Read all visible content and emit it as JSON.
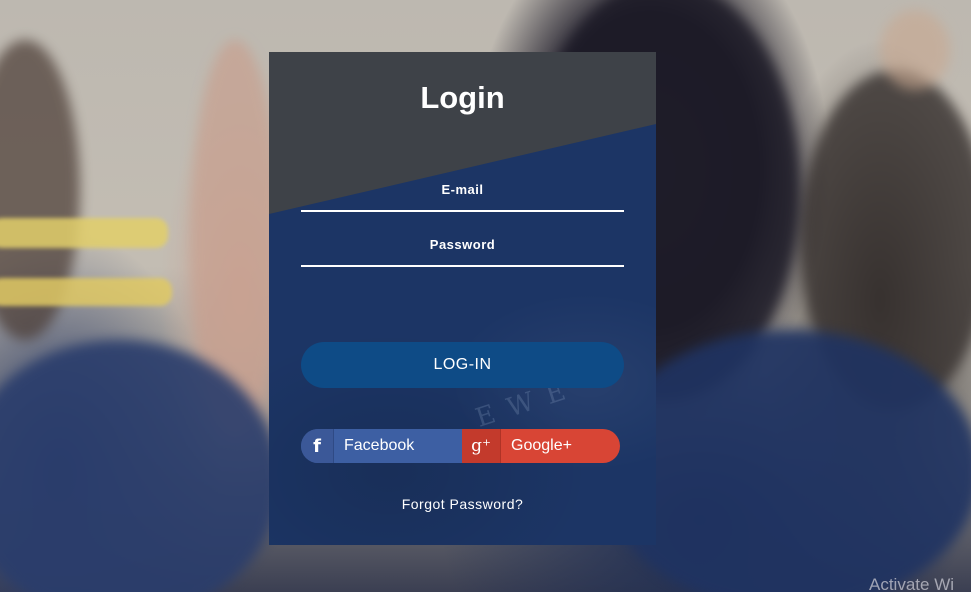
{
  "login_card": {
    "title": "Login",
    "email_label": "E-mail",
    "email_value": "",
    "password_label": "Password",
    "password_value": "",
    "login_button": "LOG-IN",
    "social": {
      "facebook": {
        "icon": "facebook-icon",
        "glyph": "f",
        "label": "Facebook",
        "color": "#3d5fa3"
      },
      "google": {
        "icon": "google-plus-icon",
        "glyph": "g⁺",
        "label": "Google+",
        "color": "#d84535"
      }
    },
    "forgot_password": "Forgot Password?",
    "accent_color": "#0e4b86"
  },
  "background": {
    "emboss_text": "EWE"
  },
  "watermark": {
    "text": "Activate Wi"
  }
}
